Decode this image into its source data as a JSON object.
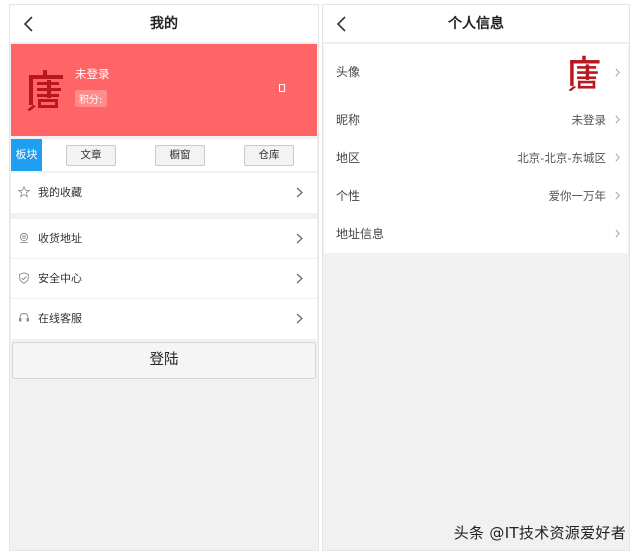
{
  "left": {
    "header": {
      "title": "我的"
    },
    "profile": {
      "username": "未登录",
      "points_label": "积分:",
      "points_value": ""
    },
    "tabs": {
      "active": "板块",
      "items": [
        "文章",
        "橱窗",
        "仓库"
      ]
    },
    "menu_group1": [
      {
        "label": "我的收藏",
        "icon": "star-icon"
      }
    ],
    "menu_group2": [
      {
        "label": "收货地址",
        "icon": "location-icon"
      },
      {
        "label": "安全中心",
        "icon": "shield-icon"
      },
      {
        "label": "在线客服",
        "icon": "headset-icon"
      }
    ],
    "login_label": "登陆"
  },
  "right": {
    "header": {
      "title": "个人信息"
    },
    "rows": [
      {
        "label": "头像",
        "value": ""
      },
      {
        "label": "昵称",
        "value": "未登录"
      },
      {
        "label": "地区",
        "value": "北京-北京-东城区"
      },
      {
        "label": "个性",
        "value": "爱你一万年"
      },
      {
        "label": "地址信息",
        "value": ""
      }
    ]
  },
  "watermark": "头条 @IT技术资源爱好者",
  "colors": {
    "profile_bg": "#ff6466",
    "tab_active": "#1e9ff2",
    "avatar": "#b8171d"
  }
}
